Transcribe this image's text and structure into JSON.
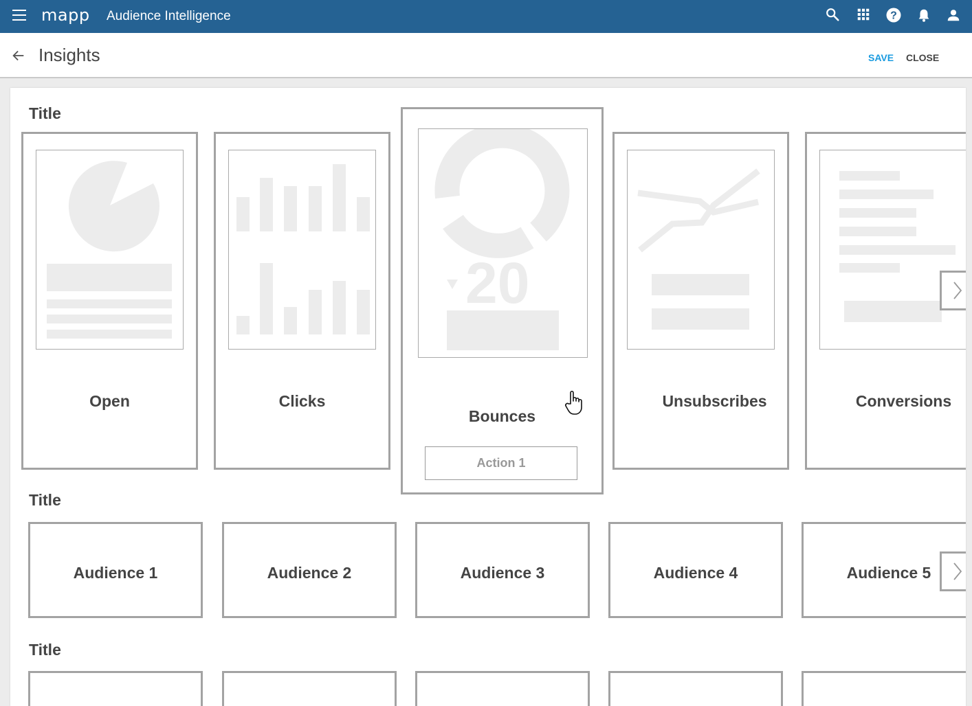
{
  "header": {
    "logo": "mapp",
    "app_title": "Audience Intelligence",
    "icons": [
      "menu-icon",
      "search-icon",
      "apps-grid-icon",
      "help-icon",
      "bell-icon",
      "account-icon"
    ]
  },
  "subheader": {
    "page_title": "Insights",
    "save_label": "SAVE",
    "close_label": "CLOSE"
  },
  "sections": [
    {
      "title": "Title",
      "cards": [
        {
          "label": "Open",
          "thumbnail": "pie-chart"
        },
        {
          "label": "Clicks",
          "thumbnail": "bar-chart"
        },
        {
          "label": "Bounces",
          "thumbnail": "donut-kpi",
          "kpi_value": "20",
          "action_label": "Action 1",
          "state": "hovered"
        },
        {
          "label": "Unsubscribes",
          "thumbnail": "line-chart"
        },
        {
          "label": "Conversions",
          "thumbnail": "text-list"
        }
      ]
    },
    {
      "title": "Title",
      "cards": [
        {
          "label": "Audience 1"
        },
        {
          "label": "Audience 2"
        },
        {
          "label": "Audience 3"
        },
        {
          "label": "Audience 4"
        },
        {
          "label": "Audience 5"
        }
      ]
    },
    {
      "title": "Title",
      "cards": []
    }
  ],
  "colors": {
    "header_bg": "#256293",
    "accent": "#1a9be0",
    "card_border": "#a3a3a3",
    "placeholder": "#ececec",
    "text": "#444444"
  }
}
